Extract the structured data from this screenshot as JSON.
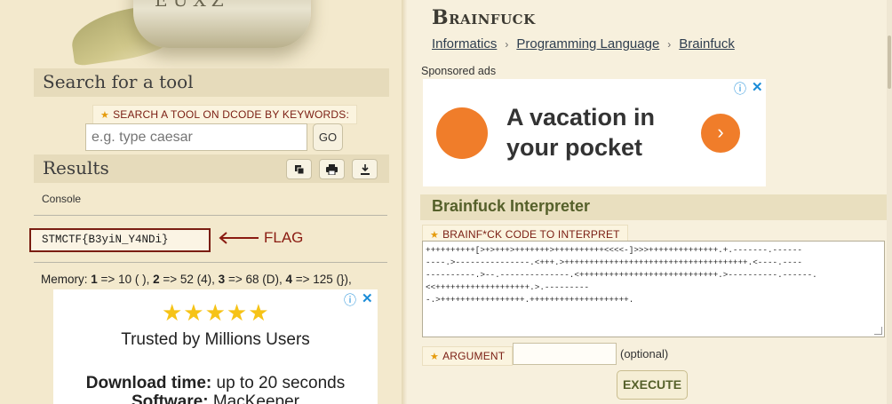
{
  "logo": {
    "letters": "EUXZ"
  },
  "search": {
    "section_title": "Search for a tool",
    "label": "SEARCH A TOOL ON DCODE BY KEYWORDS:",
    "placeholder": "e.g. type caesar",
    "go_label": "GO"
  },
  "results": {
    "section_title": "Results",
    "buttons": [
      "copy-icon",
      "print-icon",
      "download-icon"
    ],
    "console_label": "Console",
    "flag_value": "STMCTF{B3yiN_Y4NDi}",
    "flag_annotation": "FLAG",
    "memory_prefix": "Memory:",
    "memory": [
      {
        "cell": "1",
        "value": " => 10 ( ),"
      },
      {
        "cell": "2",
        "value": " => 52 (4),"
      },
      {
        "cell": "3",
        "value": " => 68 (D),"
      },
      {
        "cell": "4",
        "value": " => 125 (}),"
      }
    ]
  },
  "left_ad": {
    "stars": "★★★★★",
    "headline": "Trusted by Millions Users",
    "download_bold": "Download time:",
    "download_rest": " up to 20 seconds",
    "software_bold": "Software:",
    "software_rest": " MacKeeper"
  },
  "page": {
    "title": "Brainfuck",
    "breadcrumb": [
      "Informatics",
      "Programming Language",
      "Brainfuck"
    ],
    "sponsored": "Sponsored ads"
  },
  "right_ad": {
    "headline_line1": "A vacation in",
    "headline_line2": "your pocket",
    "accent": "#f07d2a"
  },
  "interpreter": {
    "title": "Brainfuck Interpreter",
    "code_label": "BRAINF*CK CODE TO INTERPRET",
    "code": "++++++++++[>+>+++>+++++++>++++++++++<<<<-]>>>++++++++++++++.+.-------.------\n----.>---------------.<+++.>+++++++++++++++++++++++++++++++++++++.<----.----\n----------.>--.--------------.<++++++++++++++++++++++++++++.>----------.------.\n<<+++++++++++++++++++.>.---------\n-.>+++++++++++++++++.++++++++++++++++++++.",
    "argument_label": "ARGUMENT",
    "argument_value": "",
    "optional": "(optional)",
    "execute_label": "EXECUTE"
  },
  "colors": {
    "background": "#f3e9cd",
    "section_header": "#e6dbbb",
    "flag_red": "#8a1b11",
    "accent_green": "#55602a"
  }
}
